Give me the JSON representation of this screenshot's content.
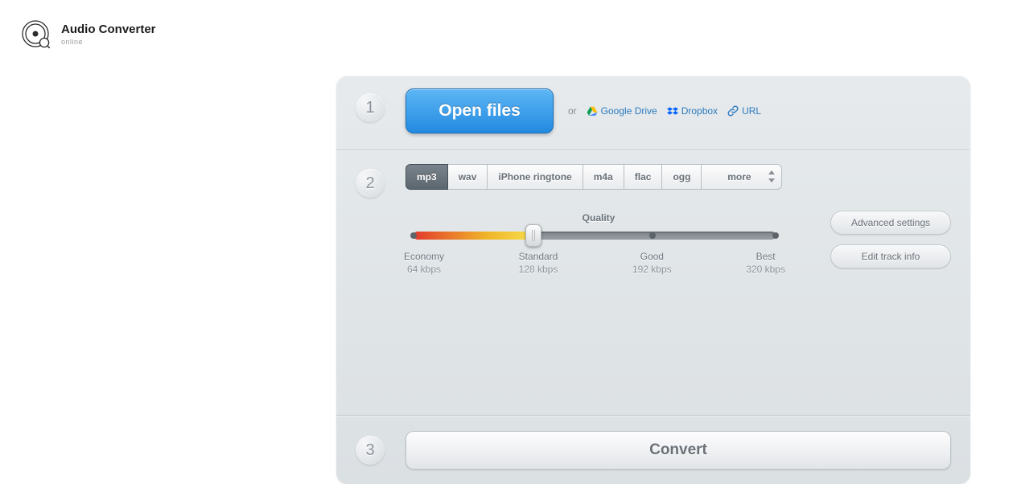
{
  "header": {
    "title": "Audio Converter",
    "subtitle": "online"
  },
  "step1": {
    "number": "1",
    "open_label": "Open files",
    "or": "or",
    "sources": {
      "gdrive": "Google Drive",
      "dropbox": "Dropbox",
      "url": "URL"
    }
  },
  "step2": {
    "number": "2",
    "formats": {
      "mp3": "mp3",
      "wav": "wav",
      "iphone": "iPhone ringtone",
      "m4a": "m4a",
      "flac": "flac",
      "ogg": "ogg",
      "more": "more"
    },
    "active_format": "mp3",
    "quality_label": "Quality",
    "quality_value_percent": 33,
    "quality_stops": [
      {
        "label": "Economy",
        "sub": "64 kbps"
      },
      {
        "label": "Standard",
        "sub": "128 kbps"
      },
      {
        "label": "Good",
        "sub": "192 kbps"
      },
      {
        "label": "Best",
        "sub": "320 kbps"
      }
    ],
    "advanced_label": "Advanced settings",
    "trackinfo_label": "Edit track info"
  },
  "step3": {
    "number": "3",
    "convert_label": "Convert"
  }
}
